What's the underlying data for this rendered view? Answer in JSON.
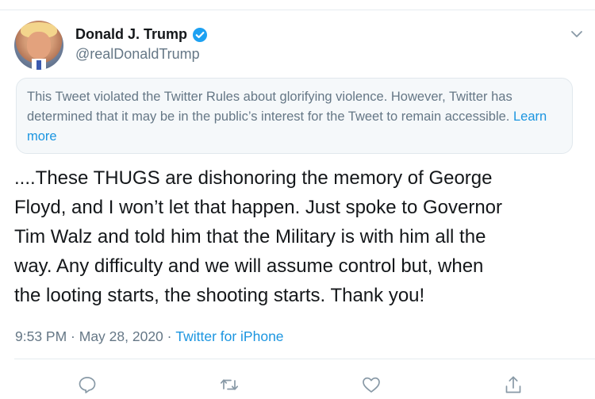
{
  "author": {
    "display_name": "Donald J. Trump",
    "handle": "@realDonaldTrump"
  },
  "notice": {
    "text": "This Tweet violated the Twitter Rules about glorifying violence. However, Twitter has determined that it may be in the public’s interest for the Tweet to remain accessible. ",
    "link_label": "Learn more"
  },
  "tweet": {
    "text": "....These THUGS are dishonoring the memory of George\nFloyd, and I won’t let that happen. Just spoke to Governor\nTim Walz and told him that the Military is with him all the\nway. Any difficulty and we will assume control but, when\nthe looting starts, the shooting starts. Thank you!",
    "time": "9:53 PM",
    "separator": " · ",
    "date": "May 28, 2020",
    "source": "Twitter for iPhone"
  },
  "icons": {
    "verified": "verified-badge-icon",
    "menu": "chevron-down-icon",
    "reply": "reply-icon",
    "retweet": "retweet-icon",
    "like": "like-icon",
    "share": "share-icon"
  },
  "colors": {
    "accent": "#1b95e0",
    "secondary_text": "#657786",
    "notice_bg": "#f5f8fa",
    "notice_border": "#e1e8ed"
  }
}
